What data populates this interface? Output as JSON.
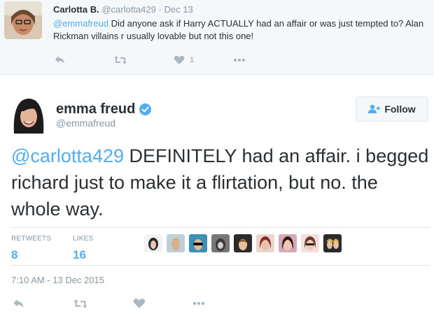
{
  "parent_tweet": {
    "name": "Carlotta B.",
    "handle": "@carlotta429",
    "separator": "·",
    "date": "Dec 13",
    "mention": "@emmafreud",
    "text": " Did anyone ask if Harry ACTUALLY had an affair or was just tempted to? Alan Rickman villains r usually lovable but not this one!",
    "like_count": "1",
    "icons": [
      "reply-icon",
      "retweet-icon",
      "heart-icon",
      "more-icon"
    ]
  },
  "main_tweet": {
    "name": "emma freud",
    "handle": "@emmafreud",
    "follow_label": "Follow",
    "mention": "@carlotta429",
    "text": " DEFINITELY had an affair.  i begged richard just to make it a flirtation, but no.  the whole way.",
    "stats": {
      "retweets_label": "RETWEETS",
      "retweets_value": "8",
      "likes_label": "LIKES",
      "likes_value": "16"
    },
    "liker_count": 9,
    "timestamp": "7:10 AM - 13 Dec 2015",
    "icons": [
      "reply-icon",
      "retweet-icon",
      "heart-icon",
      "more-icon"
    ]
  },
  "colors": {
    "accent": "#55acee",
    "muted": "#8899a6",
    "text": "#292f33",
    "parent_bg": "#f5f8fa",
    "border": "#e1e8ed"
  }
}
